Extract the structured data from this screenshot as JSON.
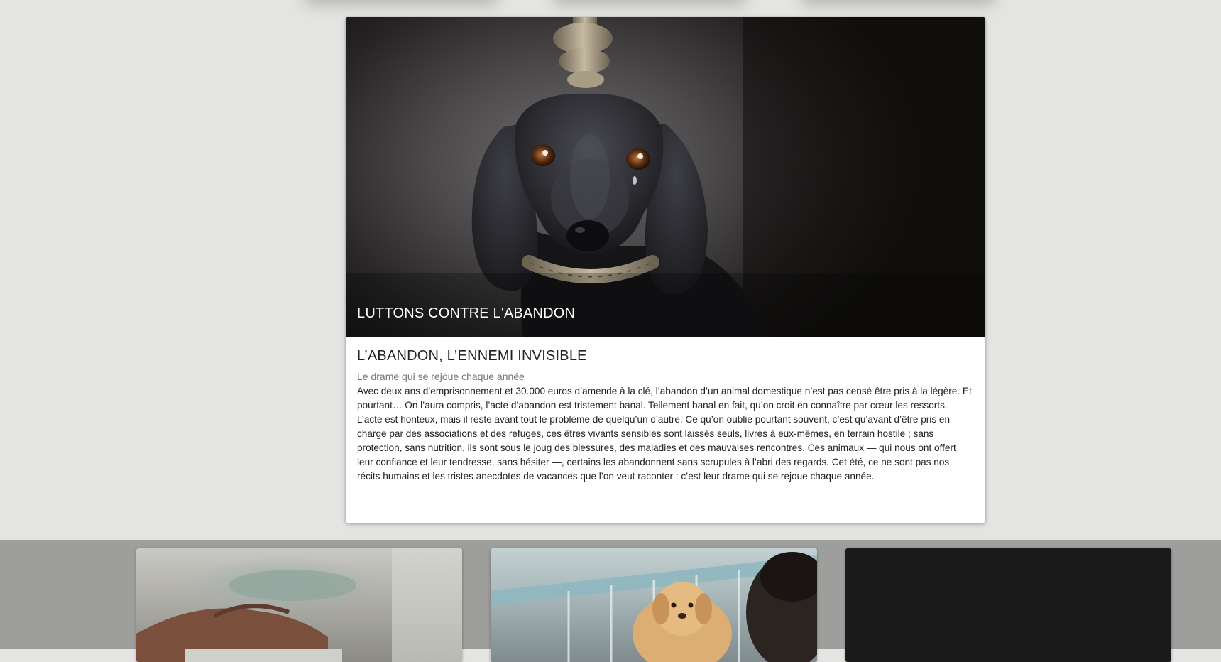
{
  "hero": {
    "title": "LUTTONS CONTRE L'ABANDON",
    "image_subject": "sad-dachshund-with-rope-photo"
  },
  "article": {
    "headline": "L’ABANDON, L’ENNEMI INVISIBLE",
    "subtitle": "Le drame qui se rejoue chaque année",
    "body": "Avec deux ans d’emprisonnement et 30.000 euros d’amende à la clé, l’abandon d’un animal domestique n’est pas censé être pris à la légère. Et pourtant… On l’aura compris, l’acte d’abandon est tristement banal. Tellement banal en fait, qu’on croit en connaître par cœur les ressorts. L’acte est honteux, mais il reste avant tout le problème de quelqu’un d’autre. Ce qu’on oublie pourtant souvent, c’est qu’avant d’être pris en charge par des associations et des refuges, ces êtres vivants sensibles sont laissés seuls, livrés à eux-mêmes, en terrain hostile ; sans protection, sans nutrition, ils sont sous le joug des blessures, des maladies et des mauvaises rencontres. Ces animaux — qui nous ont offert leur confiance et leur tendresse, sans hésiter —, certains les abandonnent sans scrupules à l’abri des regards. Cet été, ce ne sont pas nos récits humains et les tristes anecdotes de vacances que l’on veut raconter : c’est leur drame qui se rejoue chaque année."
  },
  "thumbnails": [
    {
      "subject": "hands-photo"
    },
    {
      "subject": "puppy-in-shelter-photo"
    },
    {
      "subject": "dark-photo"
    }
  ],
  "colors": {
    "page_background": "#e4e4e2",
    "band_background": "#9e9e9d",
    "card_background": "#ffffff",
    "headline_text": "#222222",
    "subtitle_text": "#757575"
  }
}
